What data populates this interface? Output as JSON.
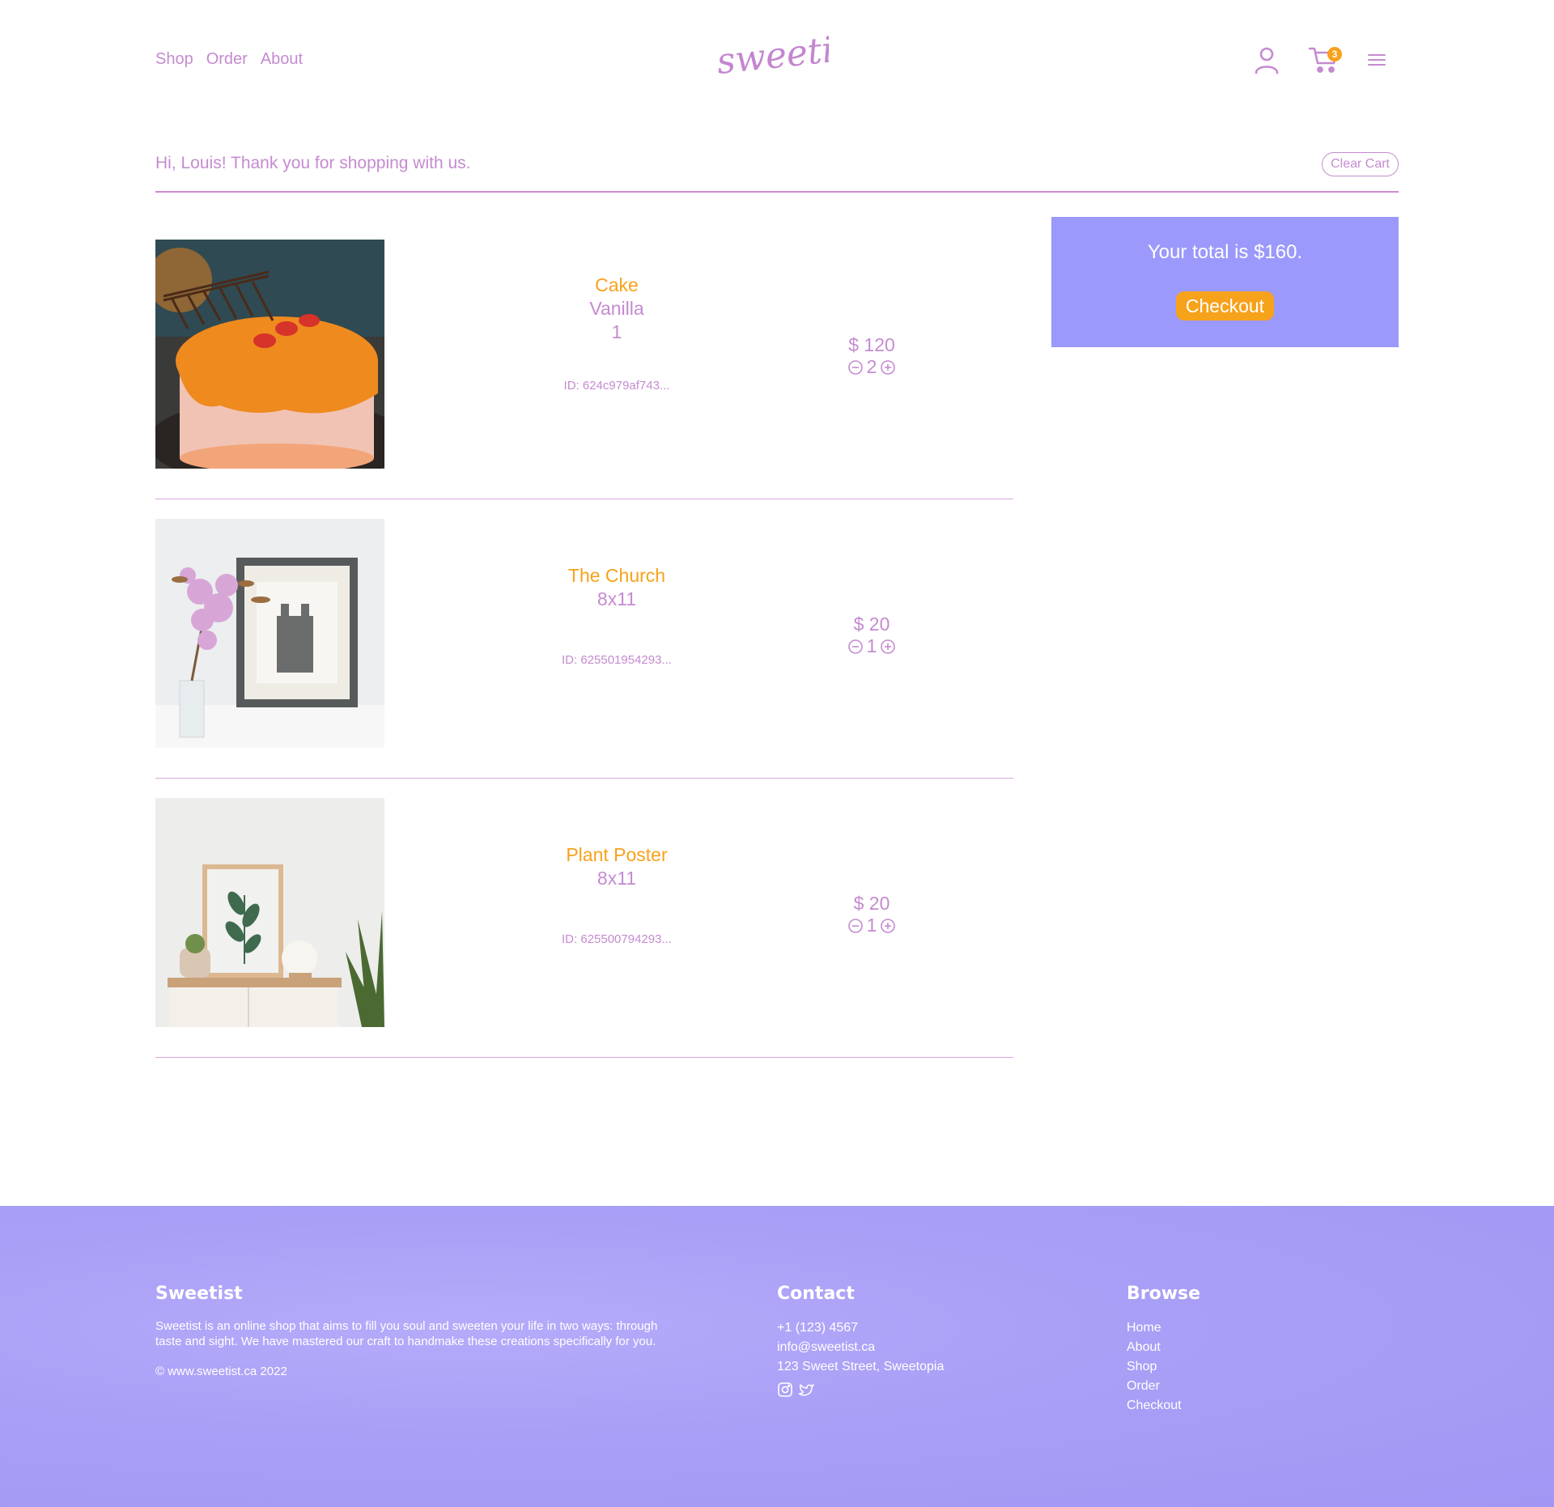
{
  "header": {
    "nav": [
      "Shop",
      "Order",
      "About"
    ],
    "logo": "sweetist",
    "cart_count": "3"
  },
  "greeting": "Hi, Louis! Thank you for shopping with us.",
  "clear_cart_label": "Clear Cart",
  "cart_items": [
    {
      "name": "Cake",
      "variant_lines": [
        "Vanilla",
        "1"
      ],
      "id": "ID: 624c979af743...",
      "price": "$ 120",
      "quantity": "2",
      "image": "orange-glazed-cake-photo"
    },
    {
      "name": "The Church",
      "variant_lines": [
        "8x11"
      ],
      "id": "ID: 625501954293...",
      "price": "$ 20",
      "quantity": "1",
      "image": "framed-church-print-with-flowers-photo"
    },
    {
      "name": "Plant Poster",
      "variant_lines": [
        "8x11"
      ],
      "id": "ID: 625500794293...",
      "price": "$ 20",
      "quantity": "1",
      "image": "framed-plant-poster-on-shelf-photo"
    }
  ],
  "summary": {
    "total_text": "Your total is $160.",
    "checkout_label": "Checkout"
  },
  "footer": {
    "about": {
      "title": "Sweetist",
      "description_line1": "Sweetist is an online shop that aims to fill you soul and sweeten your life in two ways: through",
      "description_line2": "taste and sight. We have mastered our craft to handmake these creations specifically for you.",
      "copyright": "© www.sweetist.ca 2022"
    },
    "contact": {
      "title": "Contact",
      "phone": "+1 (123) 4567",
      "email": "info@sweetist.ca",
      "address": "123 Sweet Street, Sweetopia",
      "social_icons": [
        "instagram-icon",
        "twitter-icon"
      ]
    },
    "browse": {
      "title": "Browse",
      "links": [
        "Home",
        "About",
        "Shop",
        "Order",
        "Checkout"
      ]
    }
  },
  "colors": {
    "brand_purple": "#c58bd0",
    "accent_orange": "#f7a21b",
    "summary_bg": "#9b99fb",
    "footer_bg": "#a89ff6"
  }
}
